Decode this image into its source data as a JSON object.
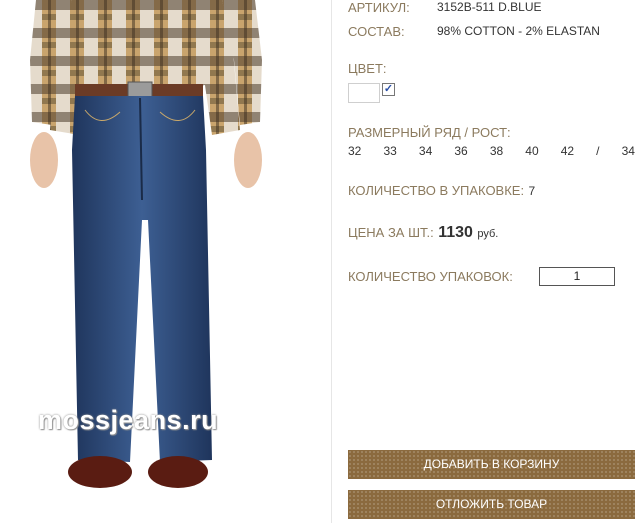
{
  "product": {
    "article_label": "АРТИКУЛ:",
    "article_value": "3152B-511 D.BLUE",
    "composition_label": "СОСТАВ:",
    "composition_value": "98% COTTON - 2% ELASTAN",
    "color_label": "ЦВЕТ:",
    "color_checked": "✓",
    "sizes_label": "РАЗМЕРНЫЙ РЯД / РОСТ:",
    "sizes": [
      "32",
      "33",
      "34",
      "36",
      "38",
      "40",
      "42",
      "/",
      "34"
    ],
    "pack_label": "КОЛИЧЕСТВО В УПАКОВКЕ:",
    "pack_value": "7",
    "price_label": "ЦЕНА ЗА ШТ.:",
    "price_value": "1130",
    "price_currency": "руб.",
    "qty_label": "КОЛИЧЕСТВО УПАКОВОК:",
    "qty_value": "1"
  },
  "photo": {
    "watermark": "mossjeans.ru",
    "icons": [
      "product-photo-jeans"
    ]
  },
  "buttons": {
    "add_to_cart": "ДОБАВИТЬ В КОРЗИНУ",
    "save_item": "ОТЛОЖИТЬ ТОВАР"
  },
  "colors": {
    "label": "#8b7a5e",
    "button": "#8b6a3e",
    "denim": "#2e4a78"
  }
}
